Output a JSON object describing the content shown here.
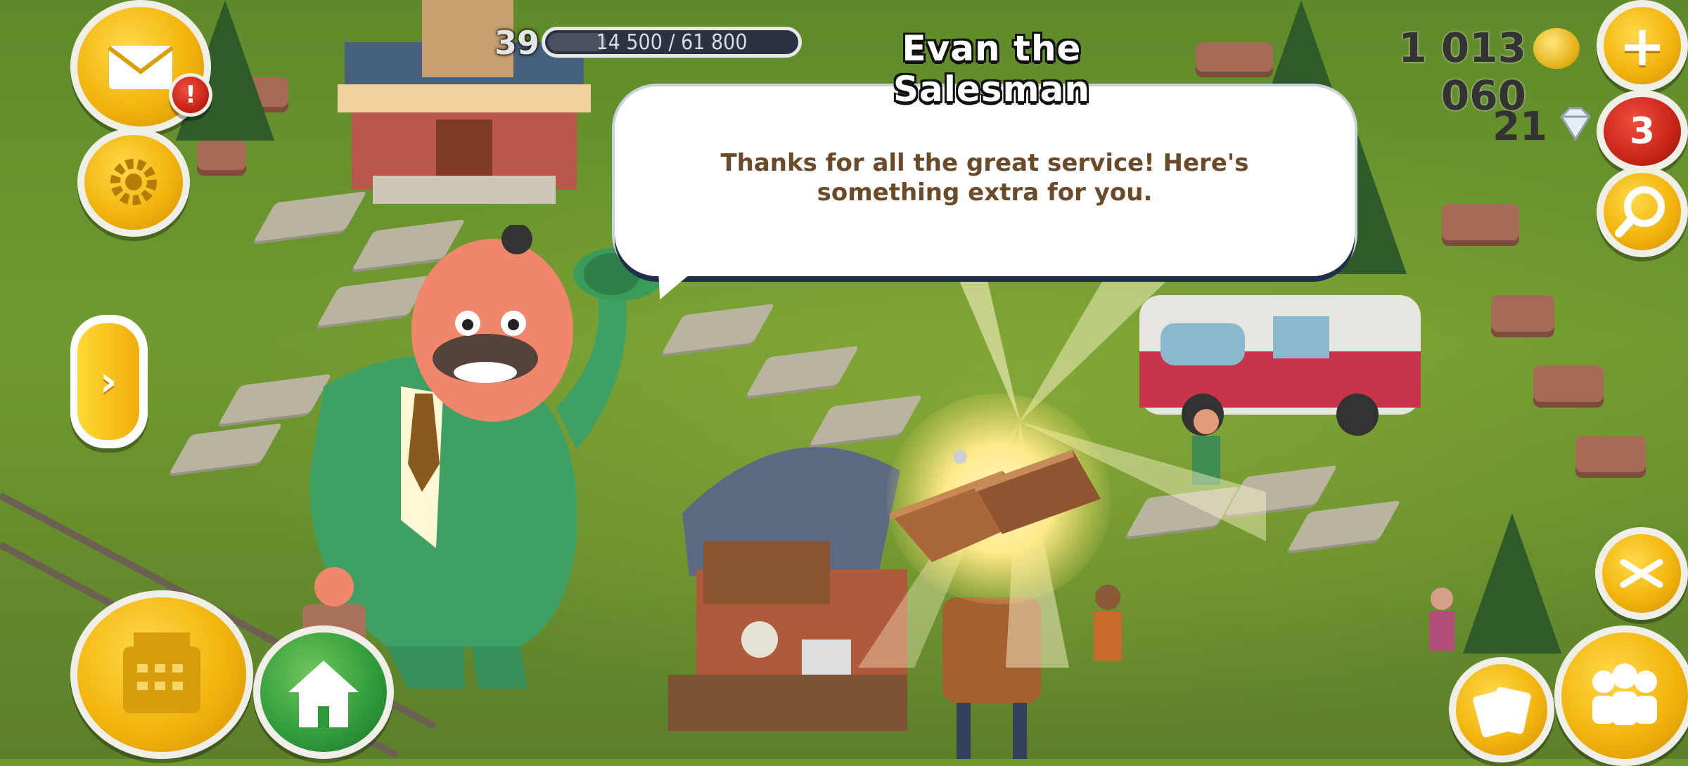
{
  "hud": {
    "level": "39",
    "xp_text": "14 500 / 61 800",
    "xp_progress": 0.235,
    "title": "Evan the Salesman",
    "coins": "1 013 060",
    "gems": "21",
    "notification_badge": "!",
    "friend_requests_badge": "3"
  },
  "dialog": {
    "message": "Thanks for all the great service! Here's something extra for you."
  },
  "reward": {
    "item_icon": "planks-icon"
  },
  "buttons": {
    "mail": "mail-icon",
    "settings": "gear-icon",
    "expand_panel": "chevron-right-icon",
    "shop": "cash-register-icon",
    "home": "house-icon",
    "add_coins": "plus-icon",
    "search": "magnifier-icon",
    "zoom": "expand-arrows-icon",
    "friends": "people-icon",
    "map_cards": "cards-icon"
  },
  "colors": {
    "accent_gold": "#f2b50d",
    "bubble_text": "#6b4a2a",
    "badge_red": "#c82518",
    "home_green": "#2f9a3a"
  }
}
